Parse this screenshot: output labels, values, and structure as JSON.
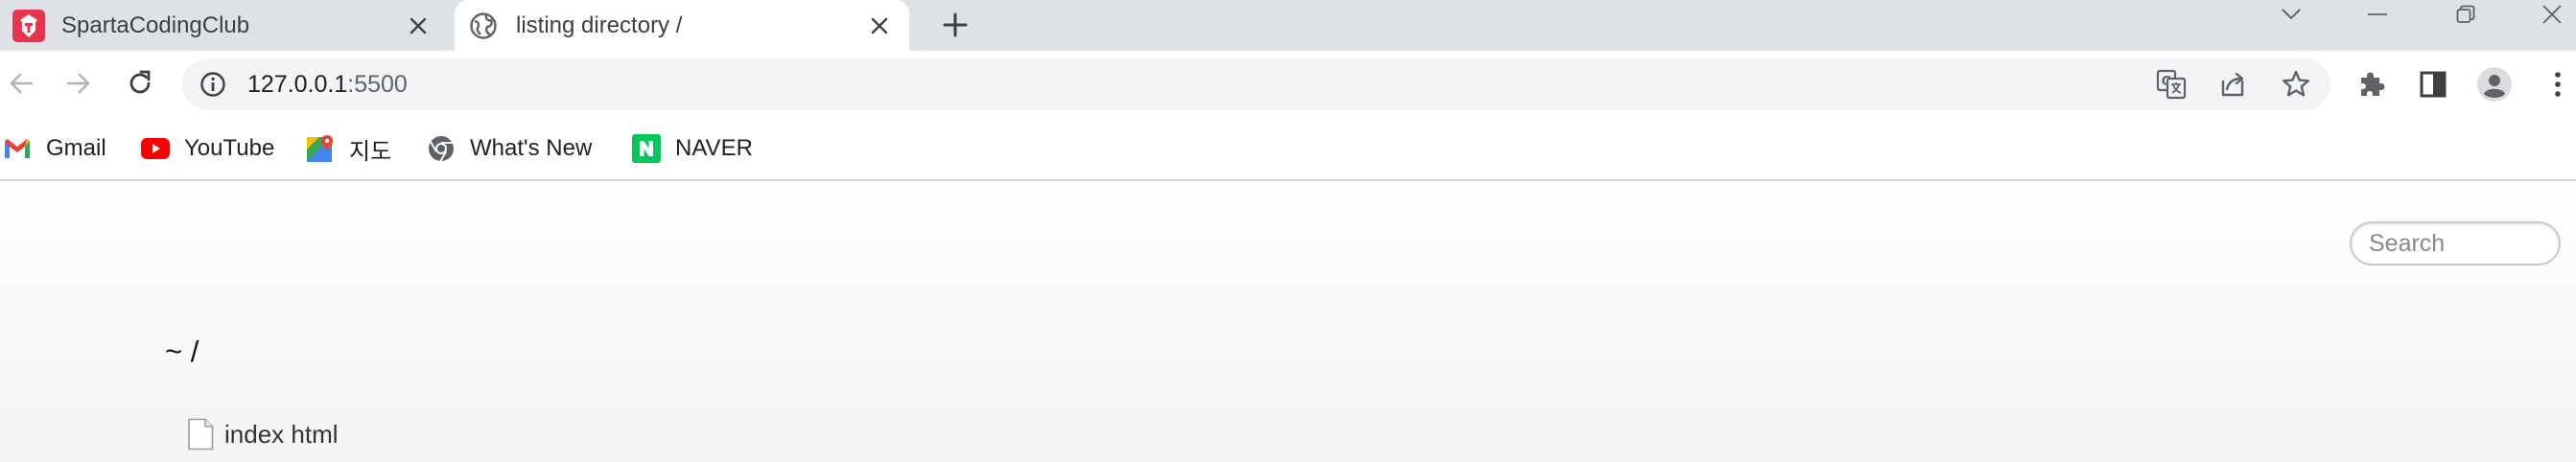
{
  "tabs": [
    {
      "title": "SpartaCodingClub",
      "favicon": "sparta-icon",
      "active": false
    },
    {
      "title": "listing directory /",
      "favicon": "globe-icon",
      "active": true
    }
  ],
  "toolbar": {
    "url_host": "127.0.0.1",
    "url_port": ":5500"
  },
  "bookmarks": [
    {
      "label": "Gmail",
      "icon": "gmail-icon"
    },
    {
      "label": "YouTube",
      "icon": "youtube-icon"
    },
    {
      "label": "지도",
      "icon": "maps-icon"
    },
    {
      "label": "What's New",
      "icon": "chrome-icon"
    },
    {
      "label": "NAVER",
      "icon": "naver-icon"
    }
  ],
  "page": {
    "search_placeholder": "Search",
    "title": "~ /",
    "files": [
      {
        "name": "index html",
        "icon": "file-icon"
      }
    ]
  },
  "colors": {
    "tabstrip_bg": "#dee1e6",
    "omnibox_bg": "#f1f3f4",
    "icon": "#5f6368",
    "sparta_red": "#e8344e",
    "youtube_red": "#ff0000",
    "naver_green": "#03c75a"
  }
}
